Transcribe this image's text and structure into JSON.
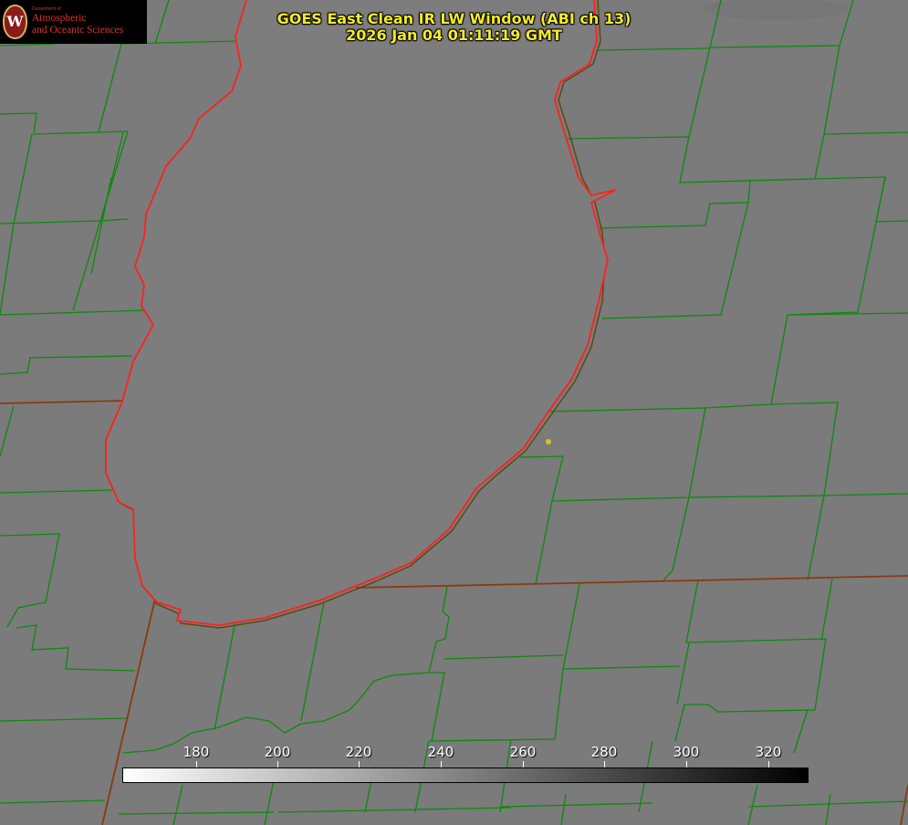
{
  "title": {
    "line1": "GOES East Clean IR LW Window (ABI ch 13)",
    "line2": "2026 Jan 04 01:11:19 GMT"
  },
  "logo": {
    "department": "Department of",
    "name_line1": "Atmospheric",
    "name_line2": "and Oceanic Sciences"
  },
  "colorbar": {
    "ticks": [
      "180",
      "200",
      "220",
      "240",
      "260",
      "280",
      "300",
      "320"
    ],
    "gradient_from": "#ffffff",
    "gradient_to": "#000000"
  },
  "colors": {
    "background": "#7b7b7b",
    "lake": "#7d7d7d",
    "county_lines": "#0c8a0c",
    "shoreline": "#ff2020",
    "state_line": "#8a3a10",
    "title": "#f2ea2a",
    "marker": "#d8c020"
  }
}
